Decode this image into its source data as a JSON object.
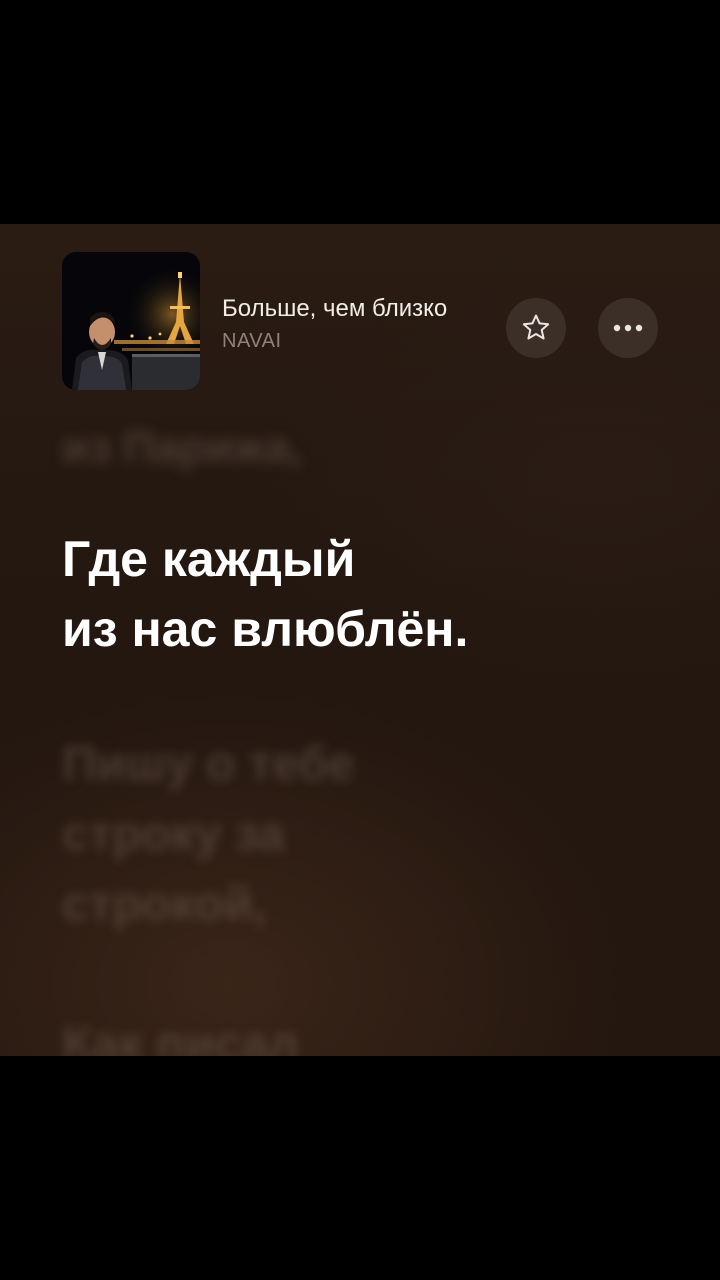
{
  "now_playing": {
    "title": "Больше, чем близко",
    "artist": "NAVAI",
    "artwork": "artist-photo-night-paris-eiffel-tower"
  },
  "controls": {
    "favorite_icon": "star-outline-icon",
    "more_icon": "ellipsis-icon"
  },
  "lyrics": {
    "previous": "из Парижа,",
    "current": [
      "Где каждый",
      "из нас влюблён."
    ],
    "next": [
      "Пишу о тебе",
      "строку за",
      "строкой,"
    ],
    "after_next": "Как писал"
  },
  "colors": {
    "background": "#241710",
    "current_lyric": "#ffffff",
    "artist_text": "#8e837a"
  }
}
